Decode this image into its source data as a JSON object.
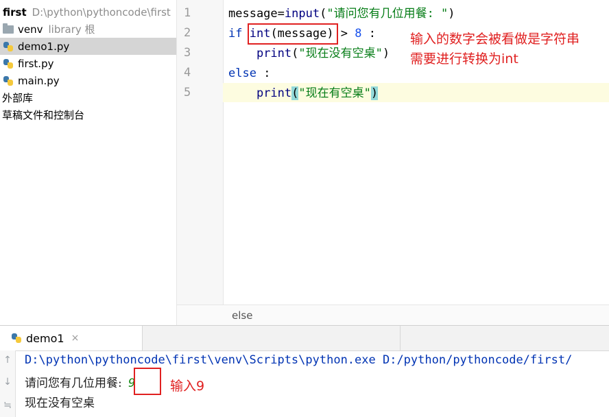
{
  "project": {
    "root_name": "first",
    "root_path": "D:\\python\\pythoncode\\first",
    "items": [
      {
        "label": "venv",
        "note": "library 根",
        "icon": "folder-icon"
      },
      {
        "label": "demo1.py",
        "icon": "python-file-icon",
        "selected": true
      },
      {
        "label": "first.py",
        "icon": "python-file-icon"
      },
      {
        "label": "main.py",
        "icon": "python-file-icon"
      },
      {
        "label": "外部库"
      },
      {
        "label": "草稿文件和控制台"
      }
    ]
  },
  "editor": {
    "line_numbers": [
      "1",
      "2",
      "3",
      "4",
      "5"
    ],
    "lines": [
      {
        "parts": [
          "message",
          "=",
          "input",
          "(",
          "\"请问您有几位用餐: \"",
          ")"
        ]
      },
      {
        "parts": [
          "if ",
          "int",
          "(message)",
          " > ",
          "8",
          " :"
        ]
      },
      {
        "parts": [
          "    ",
          "print",
          "(",
          "\"现在没有空桌\"",
          ")"
        ]
      },
      {
        "parts": [
          "else",
          " :"
        ]
      },
      {
        "parts": [
          "    ",
          "print",
          "(",
          "\"现在有空桌\"",
          ")"
        ]
      }
    ],
    "breadcrumb": "else",
    "annotation_line1": "输入的数字会被看做是字符串",
    "annotation_line2": "需要进行转换为int"
  },
  "run": {
    "tab_label": "demo1",
    "tab_close": "×",
    "tool_icons": [
      "arrow-up-icon",
      "arrow-down-icon",
      "wrap-icon"
    ],
    "command": "D:\\python\\pythoncode\\first\\venv\\Scripts\\python.exe D:/python/pythoncode/first/",
    "prompt": "请问您有几位用餐:",
    "input_value": "9",
    "input_annotation": "输入9",
    "output": "现在没有空桌"
  },
  "colors": {
    "keyword": "#0033b3",
    "string": "#067d17",
    "annotation": "#e02020",
    "selection": "#d5d5d5"
  }
}
